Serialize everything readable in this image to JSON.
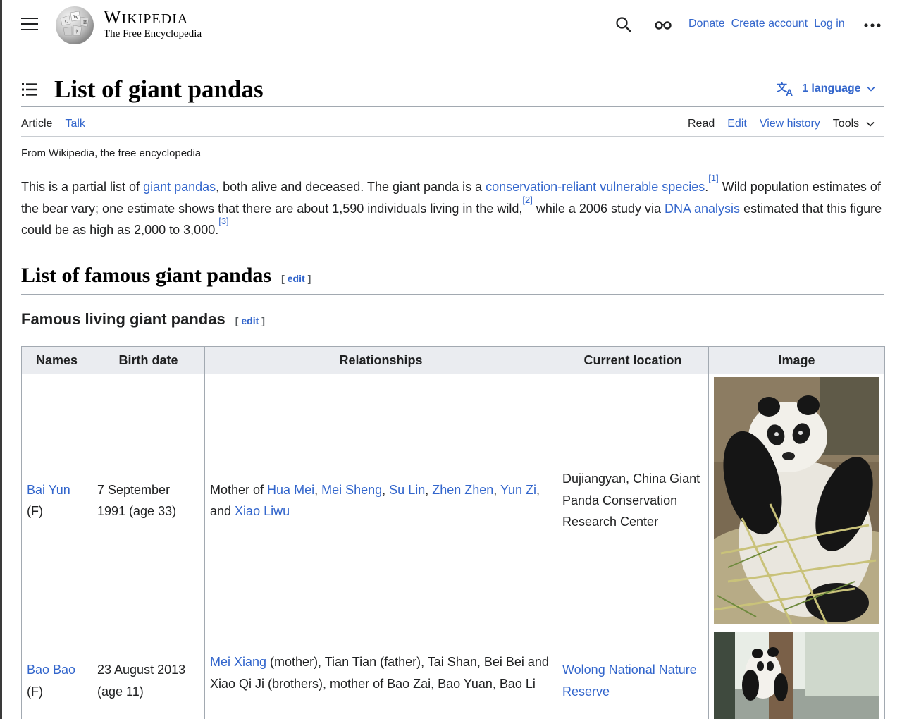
{
  "header": {
    "wordmark_title_big": "W",
    "wordmark_title_small": "IKIPEDIA",
    "wordmark_tagline": "The Free Encyclopedia",
    "links": [
      "Donate",
      "Create account",
      "Log in"
    ]
  },
  "page": {
    "title": "List of giant pandas",
    "language_label": "1 language",
    "tabs_left": [
      "Article",
      "Talk"
    ],
    "tabs_right": [
      "Read",
      "Edit",
      "View history"
    ],
    "tools_label": "Tools",
    "from_wikipedia": "From Wikipedia, the free encyclopedia"
  },
  "intro": {
    "t1": "This is a partial list of ",
    "l1": "giant pandas",
    "t2": ", both alive and deceased. The giant panda is a ",
    "l2": "conservation-reliant vulnerable species",
    "t3": ".",
    "r1": "[1]",
    "t4": " Wild population estimates of the bear vary; one estimate shows that there are about 1,590 individuals living in the wild,",
    "r2": "[2]",
    "t5": " while a 2006 study via ",
    "l3": "DNA analysis",
    "t6": " estimated that this figure could be as high as 2,000 to 3,000.",
    "r3": "[3]"
  },
  "sections": {
    "h2": "List of famous giant pandas",
    "h3": "Famous living giant pandas",
    "edit_label": "edit",
    "bracket_open": "[",
    "bracket_close": "]"
  },
  "table": {
    "headers": [
      "Names",
      "Birth date",
      "Relationships",
      "Current location",
      "Image"
    ],
    "rows": [
      {
        "name": "Bai Yun",
        "sex": "(F)",
        "birth": "7 September 1991 (age 33)",
        "rel_pre": "Mother of ",
        "rel_links": [
          "Hua Mei",
          "Mei Sheng",
          "Su Lin",
          "Zhen Zhen",
          "Yun Zi",
          "Xiao Liwu"
        ],
        "rel_sep_comma": ", ",
        "rel_sep_and": ", and ",
        "location": "Dujiangyan, China Giant Panda Conservation Research Center"
      },
      {
        "name": "Bao Bao",
        "sex": "(F)",
        "birth": "23 August 2013 (age 11)",
        "rel_link": "Mei Xiang",
        "rel_text": " (mother), Tian Tian (father), Tai Shan, Bei Bei and Xiao Qi Ji (brothers), mother of Bao Zai, Bao Yuan, Bao Li",
        "location": "Wolong National Nature Reserve"
      }
    ]
  },
  "colors": {
    "link": "#3366cc",
    "border": "#a2a9b1",
    "header_bg": "#eaecf0"
  }
}
